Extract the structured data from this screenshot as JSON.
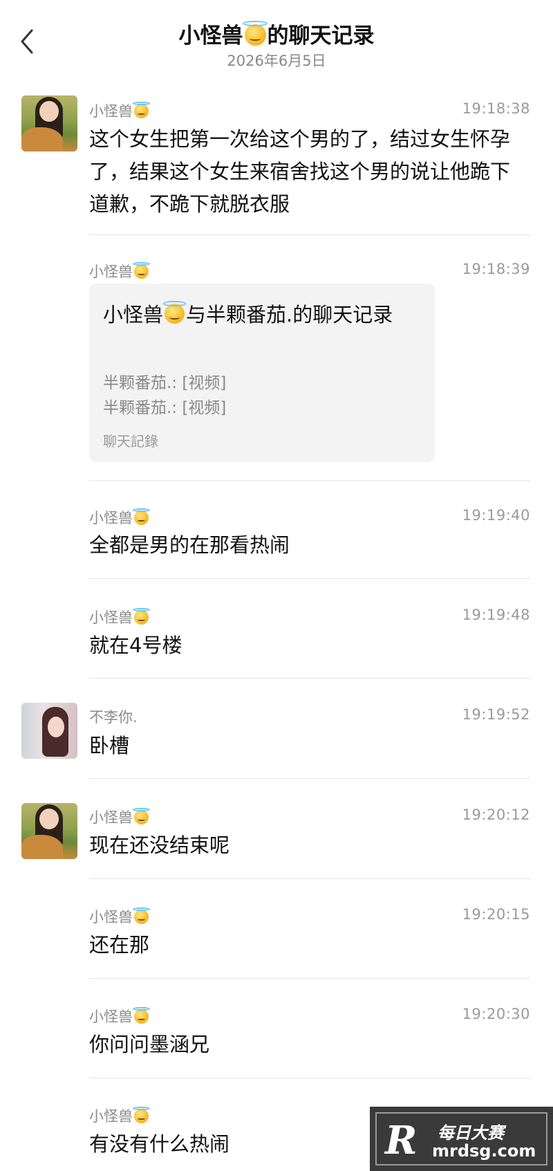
{
  "header": {
    "title_prefix": "小怪兽",
    "title_suffix": "的聊天记录",
    "date": "2026年6月5日",
    "title_emoji": "smiling-face-with-halo"
  },
  "messages": [
    {
      "sender": "小怪兽",
      "time": "19:18:38",
      "avatar": "girl-with-dog",
      "text": "这个女生把第一次给这个男的了，结过女生怀孕了，结果这个女生来宿舍找这个男的说让他跪下道歉，不跪下就脱衣服"
    },
    {
      "sender": "小怪兽",
      "time": "19:18:39",
      "avatar": "none",
      "card": {
        "title_a": "小怪兽",
        "title_b": "与半颗番茄.的聊天记录",
        "lines": [
          "半颗番茄.: [视频]",
          "半颗番茄.: [视频]"
        ],
        "footer": "聊天記錄"
      }
    },
    {
      "sender": "小怪兽",
      "time": "19:19:40",
      "avatar": "none",
      "text": "全都是男的在那看热闹"
    },
    {
      "sender": "小怪兽",
      "time": "19:19:48",
      "avatar": "none",
      "text": "就在4号楼"
    },
    {
      "sender": "不李你.",
      "time": "19:19:52",
      "avatar": "girl-long-hair",
      "text": "卧槽"
    },
    {
      "sender": "小怪兽",
      "time": "19:20:12",
      "avatar": "girl-with-dog",
      "text": "现在还没结束呢"
    },
    {
      "sender": "小怪兽",
      "time": "19:20:15",
      "avatar": "none",
      "text": "还在那"
    },
    {
      "sender": "小怪兽",
      "time": "19:20:30",
      "avatar": "none",
      "text": "你问问墨涵兄"
    },
    {
      "sender": "小怪兽",
      "time": "",
      "avatar": "none",
      "text": "有没有什么热闹"
    }
  ],
  "watermark": {
    "cn": "每日大赛",
    "url": "mrdsg.com",
    "logo": "R"
  }
}
